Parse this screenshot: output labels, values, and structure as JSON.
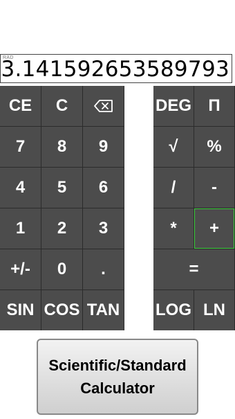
{
  "display": {
    "mode": "RAD",
    "value": "3.141592653589793"
  },
  "left_keys": [
    "CE",
    "C",
    "⌫",
    "7",
    "8",
    "9",
    "4",
    "5",
    "6",
    "1",
    "2",
    "3",
    "+/-",
    "0",
    ".",
    "SIN",
    "COS",
    "TAN"
  ],
  "right_keys": [
    {
      "label": "DEG"
    },
    {
      "label": "Π"
    },
    {
      "label": "√"
    },
    {
      "label": "%"
    },
    {
      "label": "/"
    },
    {
      "label": "-"
    },
    {
      "label": "*"
    },
    {
      "label": "+",
      "selected": true
    },
    {
      "label": "=",
      "span": 2
    },
    {
      "label": "LOG"
    },
    {
      "label": "LN"
    }
  ],
  "mode_button": {
    "line1": "Scientific/Standard",
    "line2": "Calculator"
  },
  "icons": {
    "backspace": "backspace-icon"
  },
  "colors": {
    "key_bg": "#4c4c4c",
    "key_text": "#ffffff",
    "selected_border": "#3cd03c"
  }
}
